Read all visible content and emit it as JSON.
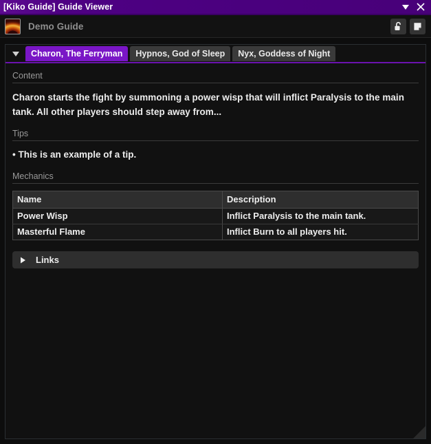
{
  "window": {
    "title": "[Kiko Guide] Guide Viewer",
    "collapse_icon": "chevron-down-icon",
    "close_icon": "close-icon",
    "accent_color": "#4a007e",
    "tab_accent_color": "#7a16c6"
  },
  "header": {
    "guide_icon": "guide-portal-icon",
    "guide_name": "Demo Guide",
    "buttons": [
      {
        "name": "unlock-button",
        "icon": "unlock-icon"
      },
      {
        "name": "notes-button",
        "icon": "note-icon"
      }
    ]
  },
  "tabs": {
    "dropdown_icon": "chevron-down-icon",
    "items": [
      {
        "label": "Charon, The Ferryman",
        "active": true
      },
      {
        "label": "Hypnos, God of Sleep",
        "active": false
      },
      {
        "label": "Nyx, Goddess of Night",
        "active": false
      }
    ]
  },
  "sections": {
    "content": {
      "label": "Content",
      "text": "Charon starts the fight by summoning a power wisp that will inflict Paralysis to the main tank. All other players should step away from..."
    },
    "tips": {
      "label": "Tips",
      "items": [
        "• This is an example of a tip."
      ]
    },
    "mechanics": {
      "label": "Mechanics",
      "columns": [
        "Name",
        "Description"
      ],
      "rows": [
        [
          "Power Wisp",
          "Inflict Paralysis to the main tank."
        ],
        [
          "Masterful Flame",
          "Inflict Burn to all players hit."
        ]
      ]
    },
    "links": {
      "label": "Links",
      "expanded": false,
      "caret_icon": "caret-right-icon"
    }
  }
}
